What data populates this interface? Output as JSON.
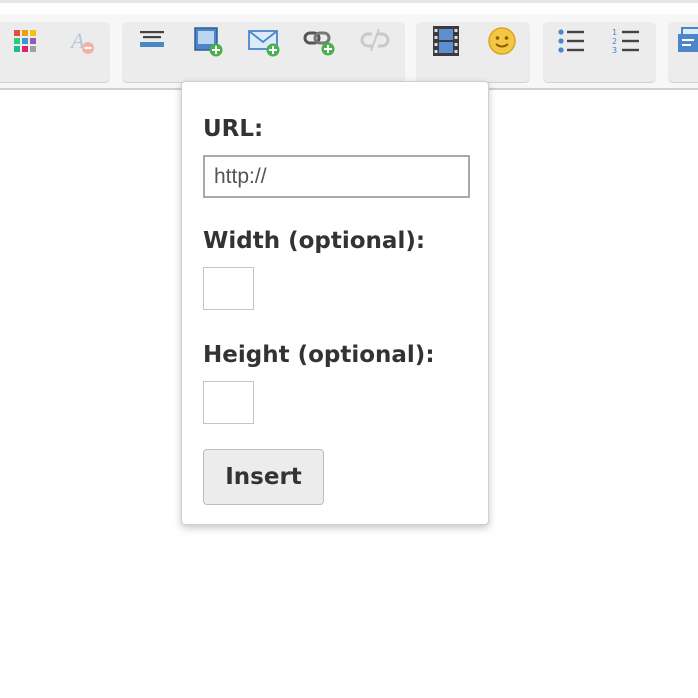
{
  "toolbar": {
    "buttons": [
      {
        "icon": "color-grid-icon",
        "enabled": true
      },
      {
        "icon": "remove-format-icon",
        "enabled": false
      },
      {
        "icon": "horizontal-rule-icon",
        "enabled": true
      },
      {
        "icon": "insert-image-icon",
        "enabled": true
      },
      {
        "icon": "insert-email-icon",
        "enabled": true
      },
      {
        "icon": "insert-link-icon",
        "enabled": true
      },
      {
        "icon": "unlink-icon",
        "enabled": false
      },
      {
        "icon": "insert-video-icon",
        "enabled": true
      },
      {
        "icon": "emoticon-icon",
        "enabled": true
      },
      {
        "icon": "bullet-list-icon",
        "enabled": true
      },
      {
        "icon": "numbered-list-icon",
        "enabled": true
      },
      {
        "icon": "source-code-icon",
        "enabled": true
      }
    ]
  },
  "popup": {
    "url_label": "URL:",
    "url_placeholder": "http://",
    "url_value": "",
    "width_label": "Width (optional):",
    "width_value": "",
    "height_label": "Height (optional):",
    "height_value": "",
    "insert_label": "Insert"
  },
  "colors": {
    "toolbar_bg": "#f7f7f7",
    "group_bg": "#ececec",
    "label_text": "#333333",
    "icon_blue": "#4a86c8",
    "plus_green": "#4caf50",
    "smiley_yellow": "#f2c744"
  }
}
